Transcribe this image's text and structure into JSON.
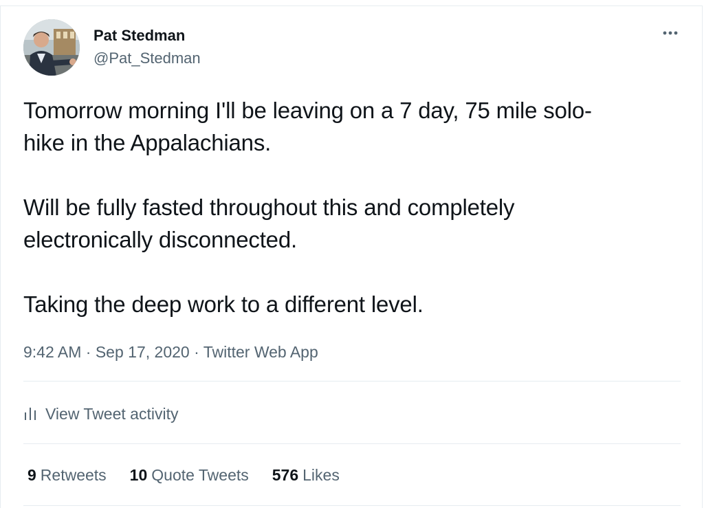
{
  "author": {
    "display_name": "Pat Stedman",
    "handle": "@Pat_Stedman"
  },
  "tweet": {
    "paragraphs": [
      "Tomorrow morning I'll be leaving on a 7 day, 75 mile solo-\nhike in the Appalachians.",
      "Will be fully fasted throughout this and completely\nelectronically disconnected.",
      "Taking the deep work to a different level."
    ]
  },
  "meta": {
    "time": "9:42 AM",
    "separator": " · ",
    "date": "Sep 17, 2020",
    "source": "Twitter Web App"
  },
  "activity": {
    "label": "View Tweet activity",
    "icon": "bar-chart-icon"
  },
  "stats": [
    {
      "count": "9",
      "label": "Retweets"
    },
    {
      "count": "10",
      "label": "Quote Tweets"
    },
    {
      "count": "576",
      "label": "Likes"
    }
  ],
  "icons": {
    "more": "more-horizontal-icon"
  },
  "colors": {
    "primary_text": "#0f1419",
    "secondary_text": "#536471",
    "divider": "#e6ecf0"
  }
}
